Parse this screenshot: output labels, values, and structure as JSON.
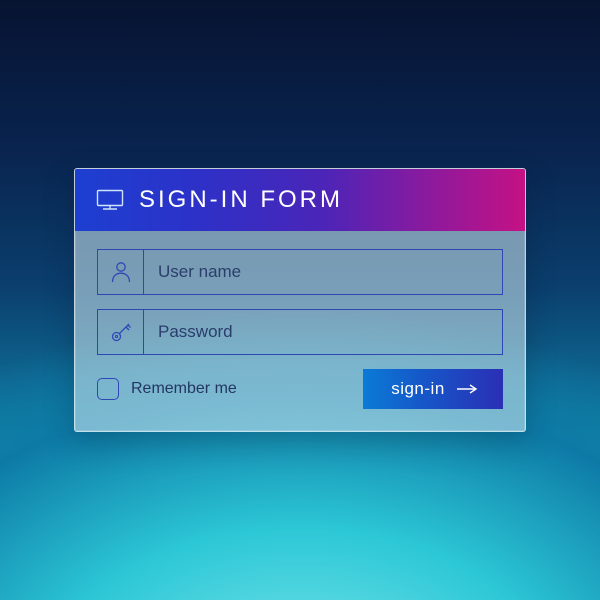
{
  "header": {
    "title": "SIGN-IN FORM",
    "icon": "monitor-icon"
  },
  "fields": {
    "username": {
      "placeholder": "User name",
      "value": "",
      "icon": "user-icon"
    },
    "password": {
      "placeholder": "Password",
      "value": "",
      "icon": "key-icon"
    }
  },
  "remember": {
    "label": "Remember me",
    "checked": false
  },
  "submit": {
    "label": "sign-in",
    "icon": "arrow-right-icon"
  },
  "colors": {
    "field_border": "#2f47b5",
    "header_gradient_from": "#1d3fd1",
    "header_gradient_to": "#c51184",
    "button_gradient_from": "#0a7bd6",
    "button_gradient_to": "#2b2fb5"
  }
}
